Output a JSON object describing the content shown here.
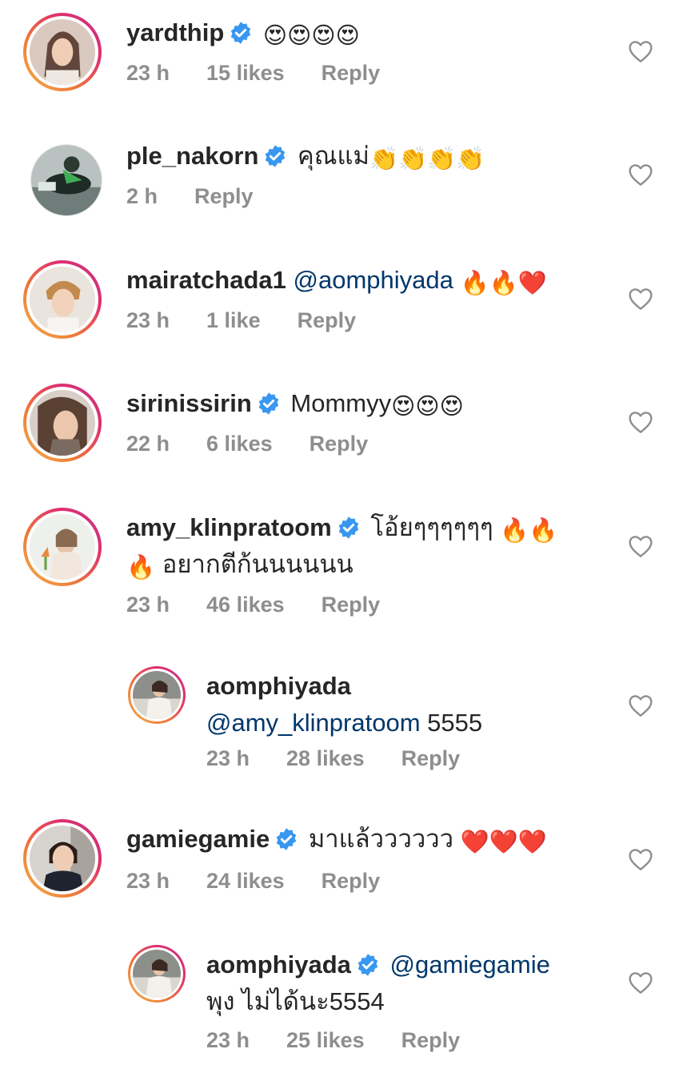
{
  "comments": [
    {
      "username": "yardthip",
      "verified": true,
      "text": "",
      "emojis": "😍😍😍😍",
      "time": "23 h",
      "likes": "15 likes",
      "reply": "Reply"
    },
    {
      "username": "ple_nakorn",
      "verified": true,
      "text": "คุณแม่",
      "emojis": "👏👏👏👏",
      "time": "2 h",
      "likes": "",
      "reply": "Reply"
    },
    {
      "username": "mairatchada1",
      "verified": false,
      "mention": "@aomphiyada",
      "emojis": "🔥🔥❤️",
      "time": "23 h",
      "likes": "1 like",
      "reply": "Reply"
    },
    {
      "username": "sirinissirin",
      "verified": true,
      "text": "Mommyy",
      "emojis": "😍😍😍",
      "time": "22 h",
      "likes": "6 likes",
      "reply": "Reply"
    },
    {
      "username": "amy_klinpratoom",
      "verified": true,
      "text": "โอ้ยๆๆๆๆๆๆ",
      "emojis": "🔥🔥",
      "line2_emoji": "🔥",
      "line2_text": "อยากตีก้นนนนนน",
      "time": "23 h",
      "likes": "46 likes",
      "reply": "Reply"
    },
    {
      "username": "aomphiyada",
      "verified": false,
      "mention": "@amy_klinpratoom",
      "text": "5555",
      "time": "23 h",
      "likes": "28 likes",
      "reply": "Reply"
    },
    {
      "username": "gamiegamie",
      "verified": true,
      "text": "มาแล้วววววว",
      "emojis": "❤️❤️❤️",
      "time": "23 h",
      "likes": "24 likes",
      "reply": "Reply"
    },
    {
      "username": "aomphiyada",
      "verified": true,
      "mention": "@gamiegamie",
      "text": "พุง ไม่ได้นะ5554",
      "time": "23 h",
      "likes": "25 likes",
      "reply": "Reply"
    }
  ],
  "colors": {
    "text": "#262626",
    "meta": "#8e8e8e",
    "mention": "#00376b",
    "verified": "#3897f0"
  }
}
